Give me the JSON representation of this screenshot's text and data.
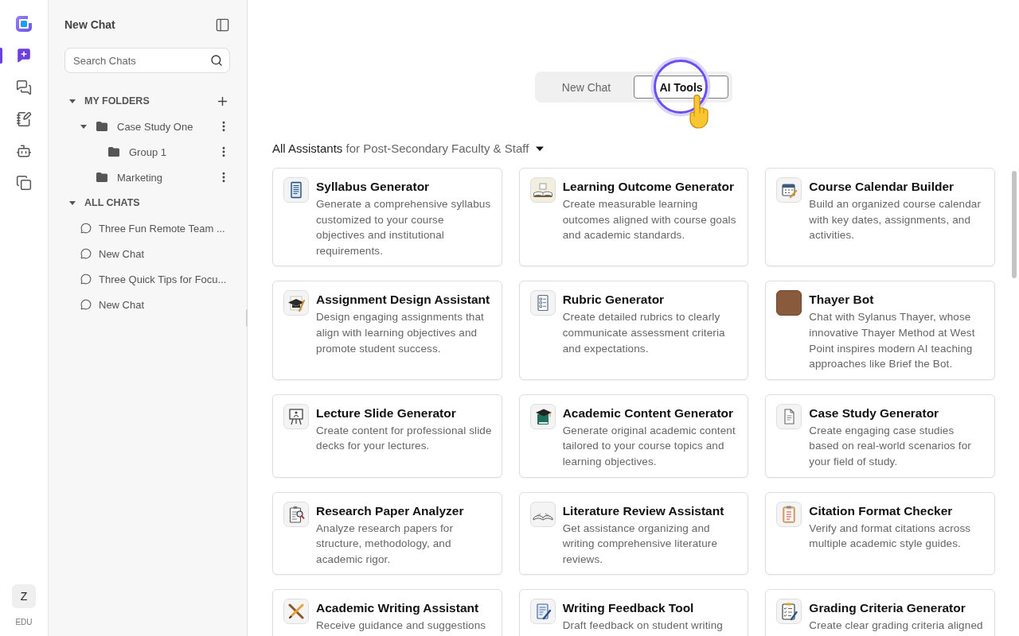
{
  "rail": {
    "items": [
      {
        "selected": true
      },
      {
        "selected": false
      },
      {
        "selected": false
      },
      {
        "selected": false
      },
      {
        "selected": false
      }
    ],
    "avatar": "Z",
    "plan": "EDU"
  },
  "sidebar": {
    "title": "New Chat",
    "search": {
      "placeholder": "Search Chats"
    },
    "folders_section": {
      "label": "MY FOLDERS",
      "expanded": true,
      "folders": [
        {
          "name": "Case Study One",
          "expanded": true,
          "children": [
            {
              "name": "Group 1"
            }
          ]
        },
        {
          "name": "Marketing"
        }
      ]
    },
    "chats_section": {
      "label": "ALL CHATS",
      "expanded": true,
      "chats": [
        {
          "title": "Three Fun Remote Team ..."
        },
        {
          "title": "New Chat"
        },
        {
          "title": "Three Quick Tips for Focu..."
        },
        {
          "title": "New Chat"
        }
      ]
    }
  },
  "main": {
    "tabs": [
      {
        "label": "New Chat",
        "selected": false
      },
      {
        "label": "AI Tools",
        "selected": true
      }
    ],
    "filter": {
      "label": "All Assistants",
      "audience": "for Post-Secondary Faculty & Staff"
    },
    "cards": [
      {
        "kind": "icon",
        "title": "Syllabus Generator",
        "description": "Generate a comprehensive syllabus customized to your course objectives and institutional requirements."
      },
      {
        "kind": "icon",
        "title": "Learning Outcome Generator",
        "description": "Create measurable learning outcomes aligned with course goals and academic standards."
      },
      {
        "kind": "icon",
        "title": "Course Calendar Builder",
        "description": "Build an organized course calendar with key dates, assignments, and activities."
      },
      {
        "kind": "icon",
        "title": "Assignment Design Assistant",
        "description": "Design engaging assignments that align with learning objectives and promote student success."
      },
      {
        "kind": "icon",
        "title": "Rubric Generator",
        "description": "Create detailed rubrics to clearly communicate assessment criteria and expectations."
      },
      {
        "kind": "photo",
        "title": "Thayer Bot",
        "description": "Chat with Sylanus Thayer, whose innovative Thayer Method at West Point inspires modern AI teaching approaches like Brief the Bot."
      },
      {
        "kind": "icon",
        "title": "Lecture Slide Generator",
        "description": "Create content for professional slide decks for your lectures."
      },
      {
        "kind": "icon",
        "title": "Academic Content Generator",
        "description": "Generate original academic content tailored to your course topics and learning objectives."
      },
      {
        "kind": "icon",
        "title": "Case Study Generator",
        "description": "Create engaging case studies based on real-world scenarios for your field of study."
      },
      {
        "kind": "icon",
        "title": "Research Paper Analyzer",
        "description": "Analyze research papers for structure, methodology, and academic rigor."
      },
      {
        "kind": "icon",
        "title": "Literature Review Assistant",
        "description": "Get assistance organizing and writing comprehensive literature reviews."
      },
      {
        "kind": "icon",
        "title": "Citation Format Checker",
        "description": "Verify and format citations across multiple academic style guides."
      },
      {
        "kind": "icon",
        "title": "Academic Writing Assistant",
        "description": "Receive guidance and suggestions"
      },
      {
        "kind": "icon",
        "title": "Writing Feedback Tool",
        "description": "Draft feedback on student writing"
      },
      {
        "kind": "icon",
        "title": "Grading Criteria Generator",
        "description": "Create clear grading criteria aligned"
      }
    ]
  }
}
